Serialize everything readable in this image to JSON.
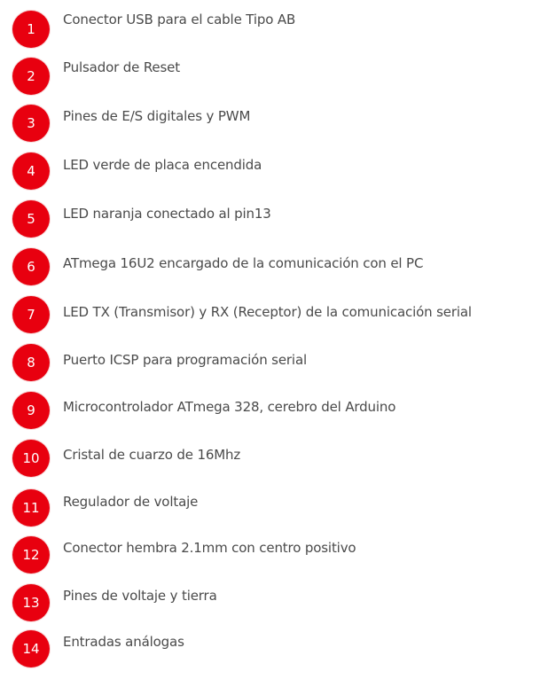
{
  "badge_color": "#e8000f",
  "text_color": "#4a4a4a",
  "items": [
    {
      "number": "1",
      "label": "Conector USB para el cable Tipo AB"
    },
    {
      "number": "2",
      "label": "Pulsador de Reset"
    },
    {
      "number": "3",
      "label": "Pines de E/S digitales y PWM"
    },
    {
      "number": "4",
      "label": "LED verde de placa encendida"
    },
    {
      "number": "5",
      "label": "LED naranja conectado al pin13"
    },
    {
      "number": "6",
      "label": "ATmega 16U2 encargado de la comunicación con el PC"
    },
    {
      "number": "7",
      "label": "LED TX (Transmisor) y RX (Receptor) de la comunicación serial"
    },
    {
      "number": "8",
      "label": "Puerto ICSP para programación serial"
    },
    {
      "number": "9",
      "label": "Microcontrolador ATmega 328, cerebro del Arduino"
    },
    {
      "number": "10",
      "label": "Cristal de cuarzo de 16Mhz"
    },
    {
      "number": "11",
      "label": "Regulador de voltaje"
    },
    {
      "number": "12",
      "label": "Conector hembra 2.1mm con centro positivo"
    },
    {
      "number": "13",
      "label": "Pines de voltaje y tierra"
    },
    {
      "number": "14",
      "label": "Entradas análogas"
    }
  ]
}
